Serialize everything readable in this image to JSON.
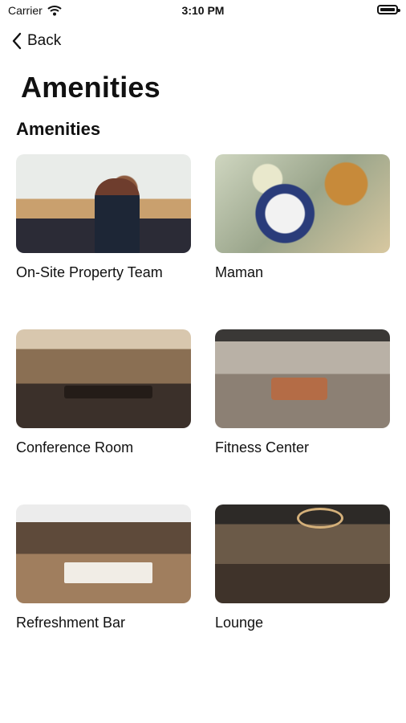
{
  "status_bar": {
    "carrier": "Carrier",
    "time": "3:10 PM"
  },
  "nav": {
    "back_label": "Back"
  },
  "page": {
    "title": "Amenities",
    "section_title": "Amenities"
  },
  "amenities": [
    {
      "label": "On-Site Property Team",
      "image": "front-desk-staff-photo"
    },
    {
      "label": "Maman",
      "image": "coffee-and-pastries-photo"
    },
    {
      "label": "Conference Room",
      "image": "conference-room-photo"
    },
    {
      "label": "Fitness Center",
      "image": "gym-equipment-photo"
    },
    {
      "label": "Refreshment Bar",
      "image": "bar-counter-photo"
    },
    {
      "label": "Lounge",
      "image": "lounge-seating-photo"
    }
  ]
}
